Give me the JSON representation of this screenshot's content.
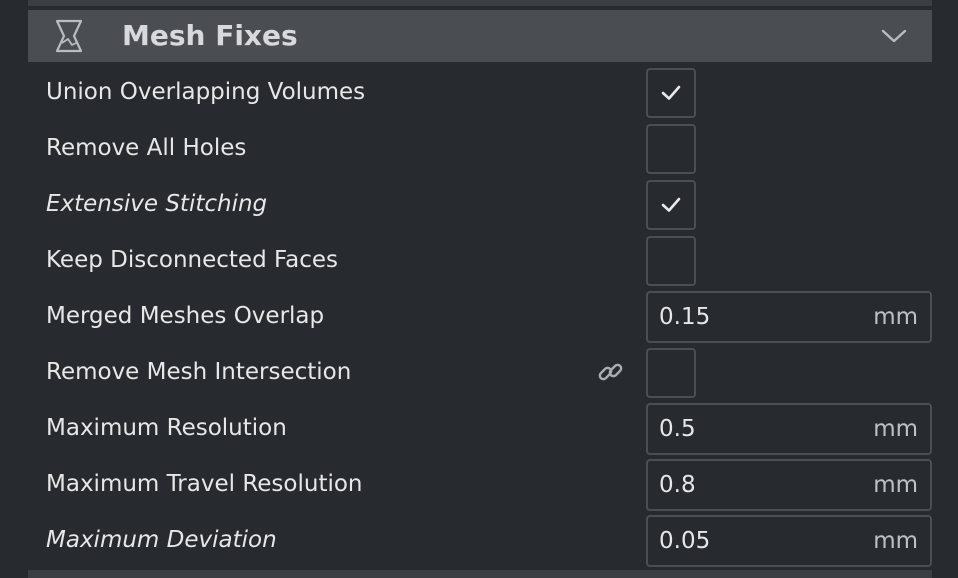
{
  "section": {
    "title": "Mesh Fixes",
    "icon": "mesh-fix-icon",
    "collapse_icon": "chevron-down-icon"
  },
  "settings": [
    {
      "label": "Union Overlapping Volumes",
      "type": "checkbox",
      "checked": true,
      "italic": false
    },
    {
      "label": "Remove All Holes",
      "type": "checkbox",
      "checked": false,
      "italic": false
    },
    {
      "label": "Extensive Stitching",
      "type": "checkbox",
      "checked": true,
      "italic": true
    },
    {
      "label": "Keep Disconnected Faces",
      "type": "checkbox",
      "checked": false,
      "italic": false
    },
    {
      "label": "Merged Meshes Overlap",
      "type": "number",
      "value": "0.15",
      "unit": "mm",
      "italic": false
    },
    {
      "label": "Remove Mesh Intersection",
      "type": "checkbox",
      "checked": false,
      "italic": false,
      "icon": "link-icon"
    },
    {
      "label": "Maximum Resolution",
      "type": "number",
      "value": "0.5",
      "unit": "mm",
      "italic": false
    },
    {
      "label": "Maximum Travel Resolution",
      "type": "number",
      "value": "0.8",
      "unit": "mm",
      "italic": false
    },
    {
      "label": "Maximum Deviation",
      "type": "number",
      "value": "0.05",
      "unit": "mm",
      "italic": true
    }
  ],
  "colors": {
    "background": "#272a2e",
    "header": "#4a4e53",
    "border": "#4b4f55"
  }
}
